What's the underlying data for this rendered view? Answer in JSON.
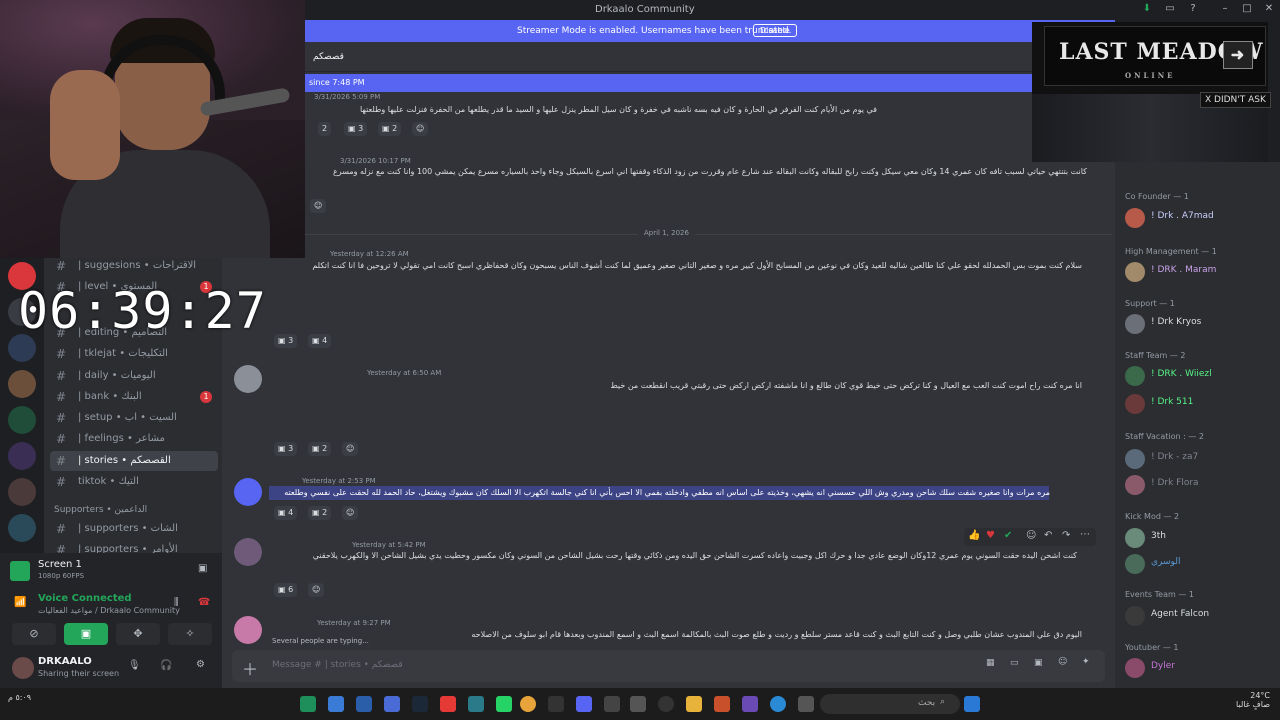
{
  "window": {
    "title": "Drkaalo Community"
  },
  "banner": {
    "text": "Streamer Mode is enabled. Usernames have been truncated.",
    "button": "Disable"
  },
  "channel_header": {
    "title": "قصصكم",
    "new_messages": "since 7:48 PM"
  },
  "clock": "06:39:27",
  "channels": [
    {
      "label": "| suggesions • الاقتراحات",
      "badge": ""
    },
    {
      "label": "| level • المستوى",
      "badge": "1"
    },
    {
      "label": "| editing • التصاميم",
      "badge": ""
    },
    {
      "label": "| tklejat • التكليجات",
      "badge": ""
    },
    {
      "label": "| daily • اليوميات",
      "badge": ""
    },
    {
      "label": "| bank • البنك",
      "badge": "1"
    },
    {
      "label": "| setup • السيت • اب",
      "badge": ""
    },
    {
      "label": "| feelings • مشاعر",
      "badge": ""
    },
    {
      "label": "| stories • القصصكم",
      "badge": ""
    },
    {
      "label": "tiktok • التيك",
      "badge": ""
    }
  ],
  "supporters_head": "Supporters • الداعمين",
  "supporters_channels": [
    "| supporters • الشات",
    "| supporters • الأوامر"
  ],
  "voice": {
    "screen_title": "Screen 1",
    "screen_sub": "1080p 60FPS",
    "connected": "Voice Connected",
    "channel": "مواعيد الفعاليات / Drkaalo Community",
    "username": "DRKAALO",
    "status": "Sharing their screen"
  },
  "messages": [
    {
      "time": "3/31/2026 5:09 PM",
      "text": "في يوم من الأيام كنت الفرفر في الحارة و كان فيه بسه ناشبه في خفرة و كان سيل المطر ينزل عليها و السيد ما قدر يطلعها من الحفرة فنزلت عليها وطلعتها",
      "reactions": [
        "2",
        "3",
        "2"
      ]
    },
    {
      "time": "3/31/2026 10:17 PM",
      "text": "كانت بتنتهي حياتي لسبب تافه كان عمري 14 وكان معي سيكل وكنت رايح للبقاله وكانت البقاله عند شارع عام وقررت من زود الذكاء وقفتها اني اسرع بالسيكل وجاء واحد بالسياره مسرع يمكن يمشي 100 وانا كنت مع نزله ومسرع",
      "reactions": []
    },
    {
      "time": "Yesterday at 12:26 AM",
      "text": "سلام كنت بموت بس الحمدلله لحقو علي كنا طالعين شاليه للعيد وكان في نوعين من المسابح الأول كبير مره و صغير التاني صغير وعميق لما كنت أشوف الناس يسبحون وكان قحفاظري اسبح كانت امي تقولي لا تروحين فا انا كنت اتكلم",
      "reactions": [
        "3",
        "4"
      ]
    },
    {
      "time": "Yesterday at 6:50 AM",
      "text": "انا مره كنت راح اموت كنت العب مع العيال و كنا تركض حتى خيط قوي كان طالع و انا ماشفته اركض اركض حتى رقبتي قريب انقطعت من خيط",
      "reactions": [
        "3",
        "2"
      ]
    },
    {
      "time": "Yesterday at 2:53 PM",
      "text": "مره مرات وانا صغيره شفت سلك شاحن ومدري وش اللي حسسني انه يشهي، وخذيته على اساس انه مطفي وادخلته بفمي الا احس بأني انا كني جالسة اتكهرب الا السلك كان مشبوك ويشتغل، حاد الحمد لله لحقت على نفسي وطلعته",
      "reactions": [
        "4",
        "2"
      ]
    },
    {
      "time": "Yesterday at 5:42 PM",
      "text": "كنت اشحن اليده حقت السوني يوم عمري 12وكان الوضع عادي جدا و حرك اكل وجبيت واعاده كسرت الشاحن حق اليده ومن ذكائي وقتها رحت بشيل الشاحن من السوني وكان مكسور وحطيت يدي بشيل الشاحن الا والكهرب يلاحقني",
      "reactions": [
        "6"
      ]
    },
    {
      "time": "Yesterday at 9:27 PM",
      "text": "اليوم دق علي المندوب عشان طلبي وصل و كنت التابع البث و كنت قاعد مستر سلطع و رديت و طلع صوت البث بالمكالمة اسمع البث و اسمع المندوب وبعدها قام ابو سلوف من الاصلاحه",
      "reactions": []
    }
  ],
  "date_divider": "April 1, 2026",
  "typing": "Several people are typing...",
  "message_placeholder": "Message # | stories • قصصكم",
  "overlay": {
    "logo": "LAST MEADOW",
    "sub": "ONLINE",
    "arrow": "➜",
    "didnt_ask": "X DIDN'T ASK"
  },
  "members": [
    {
      "head": "Co Founder — 1",
      "names": [
        "! Drk . A7mad"
      ]
    },
    {
      "head": "High Management — 1",
      "names": [
        "! DRK . Maram"
      ]
    },
    {
      "head": "Support — 1",
      "names": [
        "! Drk Kryos"
      ]
    },
    {
      "head": "Staff Team — 2",
      "names": [
        "! DRK . Wiiezl",
        "! Drk 511"
      ]
    },
    {
      "head": "Staff Vacation : — 2",
      "names": [
        "! Drk - za7",
        "! Drk Flora"
      ]
    },
    {
      "head": "Kick Mod — 2",
      "names": [
        "3th",
        "الوسري"
      ]
    },
    {
      "head": "Events Team — 1",
      "names": [
        "Agent Falcon"
      ]
    },
    {
      "head": "Youtuber — 1",
      "names": [
        "Dyler"
      ]
    }
  ],
  "taskbar": {
    "search": "بحث",
    "weather": "24°C",
    "weather_sub": "صافٍ غالبا",
    "time": "٥:٠٩ م"
  }
}
